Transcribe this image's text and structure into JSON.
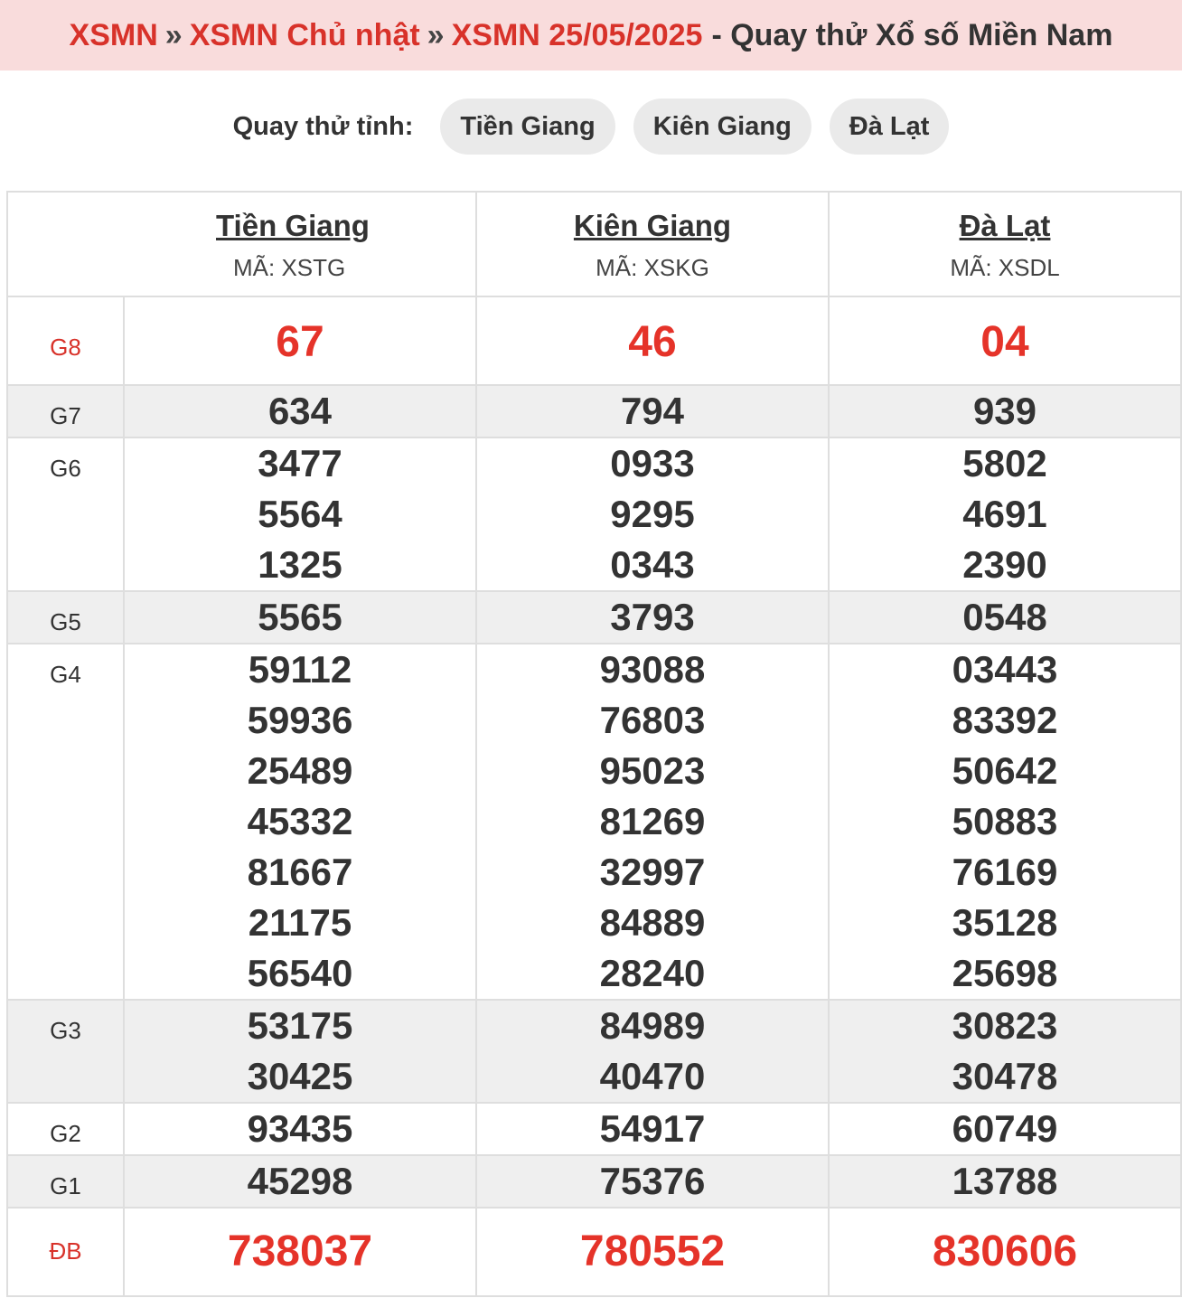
{
  "breadcrumb": {
    "items": [
      "XSMN",
      "XSMN Chủ nhật",
      "XSMN 25/05/2025"
    ],
    "separator": "»",
    "title": "- Quay thử Xổ số Miền Nam"
  },
  "province_bar": {
    "label": "Quay thử tỉnh:",
    "buttons": [
      "Tiền Giang",
      "Kiên Giang",
      "Đà Lạt"
    ]
  },
  "table": {
    "provinces": [
      {
        "name": "Tiền Giang",
        "code": "MÃ: XSTG"
      },
      {
        "name": "Kiên Giang",
        "code": "MÃ: XSKG"
      },
      {
        "name": "Đà Lạt",
        "code": "MÃ: XSDL"
      }
    ],
    "prizes": [
      {
        "label": "G8",
        "values": [
          [
            "67"
          ],
          [
            "46"
          ],
          [
            "04"
          ]
        ]
      },
      {
        "label": "G7",
        "values": [
          [
            "634"
          ],
          [
            "794"
          ],
          [
            "939"
          ]
        ]
      },
      {
        "label": "G6",
        "values": [
          [
            "3477",
            "5564",
            "1325"
          ],
          [
            "0933",
            "9295",
            "0343"
          ],
          [
            "5802",
            "4691",
            "2390"
          ]
        ]
      },
      {
        "label": "G5",
        "values": [
          [
            "5565"
          ],
          [
            "3793"
          ],
          [
            "0548"
          ]
        ]
      },
      {
        "label": "G4",
        "values": [
          [
            "59112",
            "59936",
            "25489",
            "45332",
            "81667",
            "21175",
            "56540"
          ],
          [
            "93088",
            "76803",
            "95023",
            "81269",
            "32997",
            "84889",
            "28240"
          ],
          [
            "03443",
            "83392",
            "50642",
            "50883",
            "76169",
            "35128",
            "25698"
          ]
        ]
      },
      {
        "label": "G3",
        "values": [
          [
            "53175",
            "30425"
          ],
          [
            "84989",
            "40470"
          ],
          [
            "30823",
            "30478"
          ]
        ]
      },
      {
        "label": "G2",
        "values": [
          [
            "93435"
          ],
          [
            "54917"
          ],
          [
            "60749"
          ]
        ]
      },
      {
        "label": "G1",
        "values": [
          [
            "45298"
          ],
          [
            "75376"
          ],
          [
            "13788"
          ]
        ]
      },
      {
        "label": "ĐB",
        "values": [
          [
            "738037"
          ],
          [
            "780552"
          ],
          [
            "830606"
          ]
        ]
      }
    ]
  },
  "colors": {
    "accent_red": "#d8322a",
    "highlight_red": "#e53329",
    "breadcrumb_bg": "#f9dcdc",
    "row_grey": "#efefef",
    "pill_bg": "#eaeaea"
  }
}
